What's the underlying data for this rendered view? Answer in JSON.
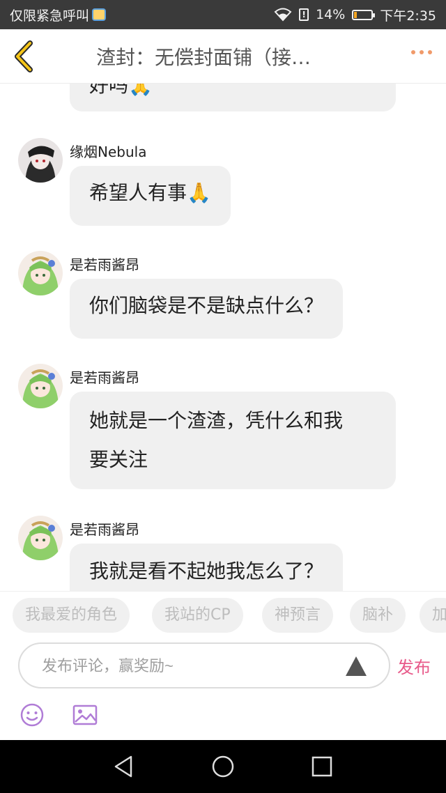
{
  "status_bar": {
    "emergency_text": "仅限紧急呼叫",
    "battery": "14%",
    "time": "下午2:35",
    "battery_level": 0.14
  },
  "header": {
    "title": "渣封：无偿封面铺（接…",
    "accent_color": "#f09a6a"
  },
  "chat": {
    "partial_message": "好吗🙏",
    "messages": [
      {
        "sender": "缘烟Nebula",
        "lines": [
          "希望人有事🙏"
        ]
      },
      {
        "sender": "是若雨酱昂",
        "lines": [
          "你们脑袋是不是缺点什么？"
        ]
      },
      {
        "sender": "是若雨酱昂",
        "lines": [
          "她就是一个渣渣，凭什么和我",
          "要关注"
        ]
      },
      {
        "sender": "是若雨酱昂",
        "lines": [
          "我就是看不起她我怎么了？"
        ]
      }
    ]
  },
  "tags": [
    "我最爱的角色",
    "我站的CP",
    "神预言",
    "脑补",
    "加"
  ],
  "comment": {
    "placeholder": "发布评论，赢奖励~",
    "publish_label": "发布",
    "publish_color": "#e85a8a"
  },
  "icons": {
    "emoji": "emoji-icon",
    "image": "image-icon",
    "send": "send-triangle-icon"
  }
}
